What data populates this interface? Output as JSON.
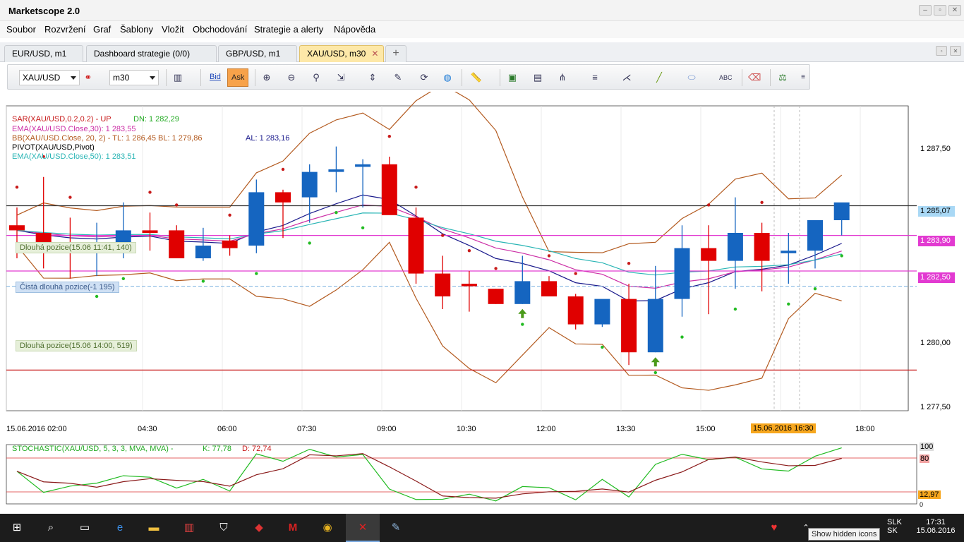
{
  "window": {
    "title": "Marketscope 2.0"
  },
  "menu": [
    "Soubor",
    "Rozvržení",
    "Graf",
    "Šablony",
    "Vložit",
    "Obchodování",
    "Strategie a alerty",
    "Nápověda"
  ],
  "tabs": [
    {
      "label": "EUR/USD, m1",
      "active": false
    },
    {
      "label": "Dashboard strategie (0/0)",
      "active": false
    },
    {
      "label": "GBP/USD, m1",
      "active": false
    },
    {
      "label": "XAU/USD, m30",
      "active": true
    }
  ],
  "tab_close": "✕",
  "tab_add": "+",
  "toolbar": {
    "symbol": "XAU/USD",
    "timeframe": "m30",
    "bid_label": "Bid",
    "ask_label": "Ask"
  },
  "legend": {
    "sar": "SAR(XAU/USD,0.2,0.2) -  UP",
    "sar_dn": "DN: 1 282,29",
    "ema30": "EMA(XAU/USD.Close,30): 1 283,55",
    "bb": "BB(XAU/USD.Close, 20, 2) -  TL: 1 286,45   BL: 1 279,86",
    "bb_al": "AL: 1 283,16",
    "pivot": "PIVOT(XAU/USD,Pivot)",
    "ema50": "EMA(XAU/USD.Close,50): 1 283,51"
  },
  "positions": [
    {
      "label": "Dlouhá pozice(15.06 11:41, 140)"
    },
    {
      "label": "Čistá dlouhá pozice(-1 195)"
    },
    {
      "label": "Dlouhá pozice(15.06 14:00, 519)"
    }
  ],
  "price_axis": {
    "ticks": [
      "1 287,50",
      "1 280,00",
      "1 277,50"
    ],
    "current": "1 285,07",
    "line1": "1 283,90",
    "line2": "1 282,50"
  },
  "time_axis": {
    "ticks": [
      "15.06.2016 02:00",
      "04:30",
      "06:00",
      "07:30",
      "09:00",
      "10:30",
      "12:00",
      "13:30",
      "15:00",
      "18:00"
    ],
    "cursor": "15.06.2016 16:30"
  },
  "stochastic": {
    "label": "STOCHASTIC(XAU/USD, 5, 3, 3, MVA, MVA) -",
    "k": "K: 77,78",
    "d": "D: 72,74",
    "levels": [
      "100",
      "80",
      "0"
    ],
    "value": "12,97"
  },
  "colors": {
    "up": "#1565c0",
    "down": "#e00000",
    "bb": "#b35a1f",
    "ema30": "#cc2fa6",
    "ema50": "#2ab5b5",
    "al": "#1a1a8c"
  },
  "chart_data": {
    "type": "candlestick",
    "symbol": "XAU/USD",
    "timeframe": "m30",
    "ylim": [
      1277.0,
      1289.0
    ],
    "candles": [
      {
        "o": 1284.3,
        "h": 1285.0,
        "l": 1283.0,
        "c": 1284.1
      },
      {
        "o": 1284.0,
        "h": 1286.2,
        "l": 1282.6,
        "c": 1283.3
      },
      {
        "o": 1283.6,
        "h": 1284.6,
        "l": 1282.2,
        "c": 1283.4
      },
      {
        "o": 1283.6,
        "h": 1284.4,
        "l": 1282.3,
        "c": 1283.6
      },
      {
        "o": 1283.2,
        "h": 1285.2,
        "l": 1283.0,
        "c": 1284.1
      },
      {
        "o": 1284.1,
        "h": 1284.8,
        "l": 1283.3,
        "c": 1284.0
      },
      {
        "o": 1284.1,
        "h": 1284.3,
        "l": 1283.2,
        "c": 1283.0
      },
      {
        "o": 1283.0,
        "h": 1284.2,
        "l": 1282.9,
        "c": 1283.5
      },
      {
        "o": 1283.7,
        "h": 1283.9,
        "l": 1283.1,
        "c": 1283.4
      },
      {
        "o": 1283.5,
        "h": 1286.1,
        "l": 1283.2,
        "c": 1285.6
      },
      {
        "o": 1285.6,
        "h": 1285.7,
        "l": 1283.8,
        "c": 1285.2
      },
      {
        "o": 1285.4,
        "h": 1286.7,
        "l": 1284.4,
        "c": 1286.4
      },
      {
        "o": 1286.4,
        "h": 1287.4,
        "l": 1285.6,
        "c": 1286.5
      },
      {
        "o": 1286.6,
        "h": 1286.9,
        "l": 1285.0,
        "c": 1286.7
      },
      {
        "o": 1286.7,
        "h": 1287.0,
        "l": 1284.9,
        "c": 1284.7
      },
      {
        "o": 1284.6,
        "h": 1285.0,
        "l": 1282.0,
        "c": 1282.4
      },
      {
        "o": 1282.4,
        "h": 1283.1,
        "l": 1281.0,
        "c": 1281.5
      },
      {
        "o": 1282.0,
        "h": 1282.5,
        "l": 1280.9,
        "c": 1281.9
      },
      {
        "o": 1281.8,
        "h": 1281.8,
        "l": 1281.2,
        "c": 1281.2
      },
      {
        "o": 1281.2,
        "h": 1283.1,
        "l": 1281.2,
        "c": 1282.1
      },
      {
        "o": 1282.1,
        "h": 1282.3,
        "l": 1281.5,
        "c": 1281.5
      },
      {
        "o": 1281.5,
        "h": 1281.6,
        "l": 1280.2,
        "c": 1280.4
      },
      {
        "o": 1280.4,
        "h": 1281.3,
        "l": 1280.3,
        "c": 1281.4
      },
      {
        "o": 1281.4,
        "h": 1282.0,
        "l": 1278.8,
        "c": 1279.3
      },
      {
        "o": 1279.3,
        "h": 1282.7,
        "l": 1279.3,
        "c": 1281.4
      },
      {
        "o": 1281.4,
        "h": 1284.3,
        "l": 1280.7,
        "c": 1283.4
      },
      {
        "o": 1283.4,
        "h": 1284.3,
        "l": 1280.8,
        "c": 1282.9
      },
      {
        "o": 1282.9,
        "h": 1285.4,
        "l": 1281.8,
        "c": 1284.0
      },
      {
        "o": 1284.0,
        "h": 1284.4,
        "l": 1281.7,
        "c": 1282.9
      },
      {
        "o": 1283.2,
        "h": 1284.0,
        "l": 1282.0,
        "c": 1283.3
      },
      {
        "o": 1283.3,
        "h": 1284.2,
        "l": 1282.6,
        "c": 1284.5
      },
      {
        "o": 1284.5,
        "h": 1285.1,
        "l": 1283.9,
        "c": 1285.2
      }
    ],
    "horizontal_lines": [
      1285.07,
      1283.9,
      1282.5,
      1281.9,
      1278.6
    ],
    "stochastic": {
      "k": 77.78,
      "d": 72.74
    }
  }
}
